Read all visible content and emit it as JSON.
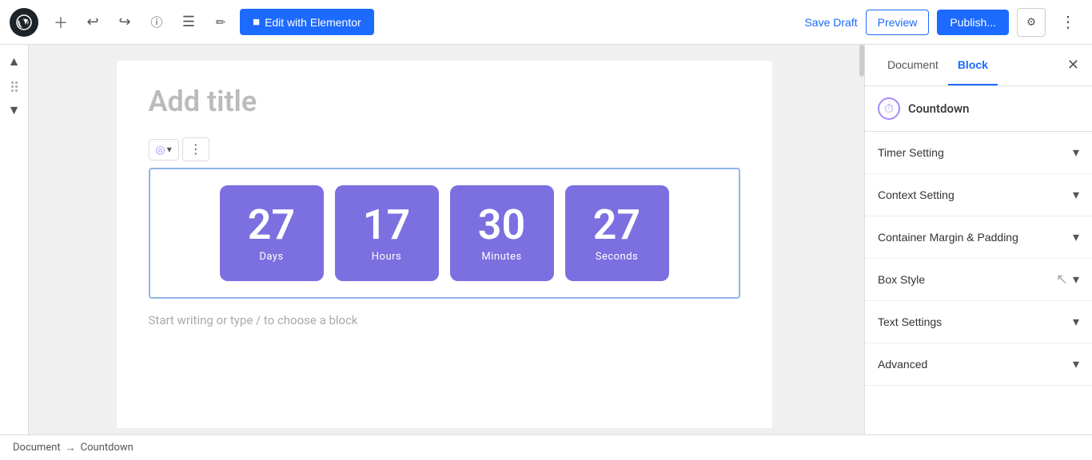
{
  "toolbar": {
    "edit_elementor_label": "Edit with Elementor",
    "save_draft_label": "Save Draft",
    "preview_label": "Preview",
    "publish_label": "Publish...",
    "icons": {
      "add": "+",
      "undo": "↩",
      "redo": "↪",
      "info": "ℹ",
      "list": "☰",
      "edit": "✏"
    }
  },
  "editor": {
    "page_title_placeholder": "Add title",
    "writing_hint": "Start writing or type / to choose a block"
  },
  "countdown": {
    "boxes": [
      {
        "number": "27",
        "label": "Days"
      },
      {
        "number": "17",
        "label": "Hours"
      },
      {
        "number": "30",
        "label": "Minutes"
      },
      {
        "number": "27",
        "label": "Seconds"
      }
    ]
  },
  "right_sidebar": {
    "tabs": [
      {
        "label": "Document",
        "active": false
      },
      {
        "label": "Block",
        "active": true
      }
    ],
    "countdown_title": "Countdown",
    "accordion_items": [
      {
        "label": "Timer Setting"
      },
      {
        "label": "Context Setting"
      },
      {
        "label": "Container Margin & Padding"
      },
      {
        "label": "Box Style"
      },
      {
        "label": "Text Settings"
      },
      {
        "label": "Advanced"
      }
    ]
  },
  "status_bar": {
    "doc_label": "Document",
    "arrow": "→",
    "block_label": "Countdown"
  }
}
